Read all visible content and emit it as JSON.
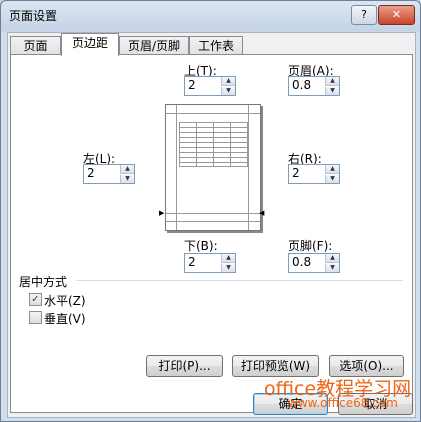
{
  "window": {
    "title": "页面设置",
    "help_glyph": "?",
    "close_glyph": "✕"
  },
  "tabs": [
    {
      "label": "页面",
      "active": false
    },
    {
      "label": "页边距",
      "active": true
    },
    {
      "label": "页眉/页脚",
      "active": false
    },
    {
      "label": "工作表",
      "active": false
    }
  ],
  "margins": {
    "top": {
      "label": "上(T):",
      "value": "2"
    },
    "bottom": {
      "label": "下(B):",
      "value": "2"
    },
    "left": {
      "label": "左(L):",
      "value": "2"
    },
    "right": {
      "label": "右(R):",
      "value": "2"
    },
    "header": {
      "label": "页眉(A):",
      "value": "0.8"
    },
    "footer": {
      "label": "页脚(F):",
      "value": "0.8"
    }
  },
  "center_on_page": {
    "title": "居中方式",
    "horizontal": {
      "label": "水平(Z)",
      "checked": true
    },
    "vertical": {
      "label": "垂直(V)",
      "checked": false
    }
  },
  "buttons": {
    "print": "打印(P)...",
    "print_preview": "打印预览(W)",
    "options": "选项(O)...",
    "ok": "确定",
    "cancel": "取消"
  },
  "watermark": {
    "line1": "office教程学习网",
    "line2": "www.office68.com"
  },
  "icons": {
    "spin_up": "▲",
    "spin_down": "▼",
    "check": "✓",
    "marker_right": "▶",
    "marker_left": "◀"
  }
}
